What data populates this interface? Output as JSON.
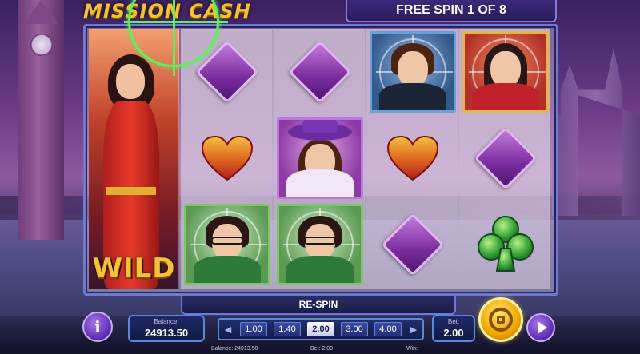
{
  "game": {
    "logo_text": "MISSION CASH"
  },
  "header": {
    "free_spin_label": "FREE SPIN 1 OF 8"
  },
  "reels": {
    "wild_label": "WILD",
    "symbols": [
      [
        "wild-agent",
        "wild-agent",
        "wild-agent"
      ],
      [
        "diamond",
        "heart",
        "nerd-agent"
      ],
      [
        "diamond",
        "hat-lady",
        "nerd-agent"
      ],
      [
        "spy-man",
        "heart",
        "diamond"
      ],
      [
        "red-lady",
        "diamond",
        "club"
      ]
    ]
  },
  "controls": {
    "respin_label": "RE-SPIN",
    "info_label": "i",
    "balance_label": "Balance:",
    "balance_value": "24913.50",
    "bet_label": "Bet:",
    "bet_value": "2.00",
    "bet_options": [
      "1.00",
      "1.40",
      "2.00",
      "3.00",
      "4.00"
    ],
    "bet_selected": "2.00",
    "prev_icon": "minus-icon",
    "next_icon": "plus-icon"
  },
  "footer": {
    "balance": "Balance: 24913.50",
    "bet": "Bet: 2.00",
    "win": "Win:"
  },
  "colors": {
    "accent_gold": "#f2c230",
    "frame_blue": "#6c7ad0",
    "crosshair_green": "#5ef05e",
    "spin_gold": "#f2a600",
    "button_purple": "#5a2ab0"
  }
}
